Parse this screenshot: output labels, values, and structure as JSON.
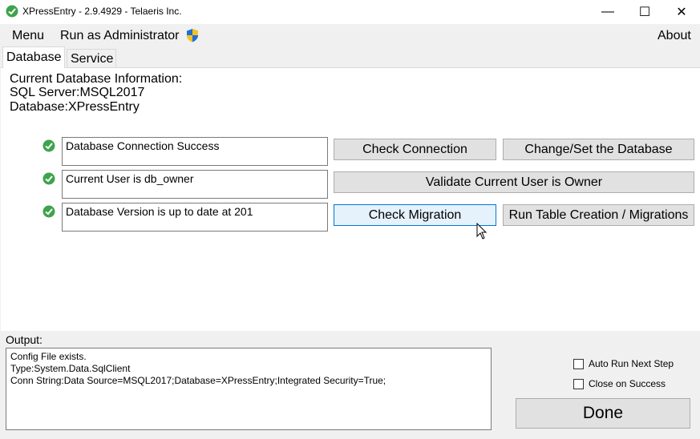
{
  "window": {
    "title": "XPressEntry - 2.9.4929 - Telaeris Inc.",
    "minimize": "—",
    "maximize": "☐",
    "close": "✕"
  },
  "menu": {
    "menu_label": "Menu",
    "run_as_admin_label": "Run as Administrator",
    "about_label": "About"
  },
  "tabs": [
    {
      "label": "Database",
      "active": true
    },
    {
      "label": "Service",
      "active": false
    }
  ],
  "db_info": {
    "heading": "Current Database Information:",
    "sql_server": "SQL Server:MSQL2017",
    "database": "Database:XPressEntry"
  },
  "checks": [
    {
      "status": "Database Connection Success",
      "ok": true
    },
    {
      "status": "Current User is db_owner",
      "ok": true
    },
    {
      "status": "Database Version is up to date at 201",
      "ok": true
    }
  ],
  "buttons": {
    "check_connection": "Check Connection",
    "change_database": "Change/Set the Database",
    "validate_owner": "Validate Current User is Owner",
    "check_migration": "Check Migration",
    "run_migrations": "Run Table Creation / Migrations",
    "done": "Done"
  },
  "output": {
    "label": "Output:",
    "lines": [
      "Config File exists.",
      "Type:System.Data.SqlClient",
      "Conn String:Data Source=MSQL2017;Database=XPressEntry;Integrated Security=True;"
    ]
  },
  "options": {
    "auto_run_label": "Auto Run Next Step",
    "auto_run_checked": false,
    "close_on_success_label": "Close on Success",
    "close_on_success_checked": false
  },
  "colors": {
    "accent": "#0078d7",
    "success": "#4caf50"
  }
}
